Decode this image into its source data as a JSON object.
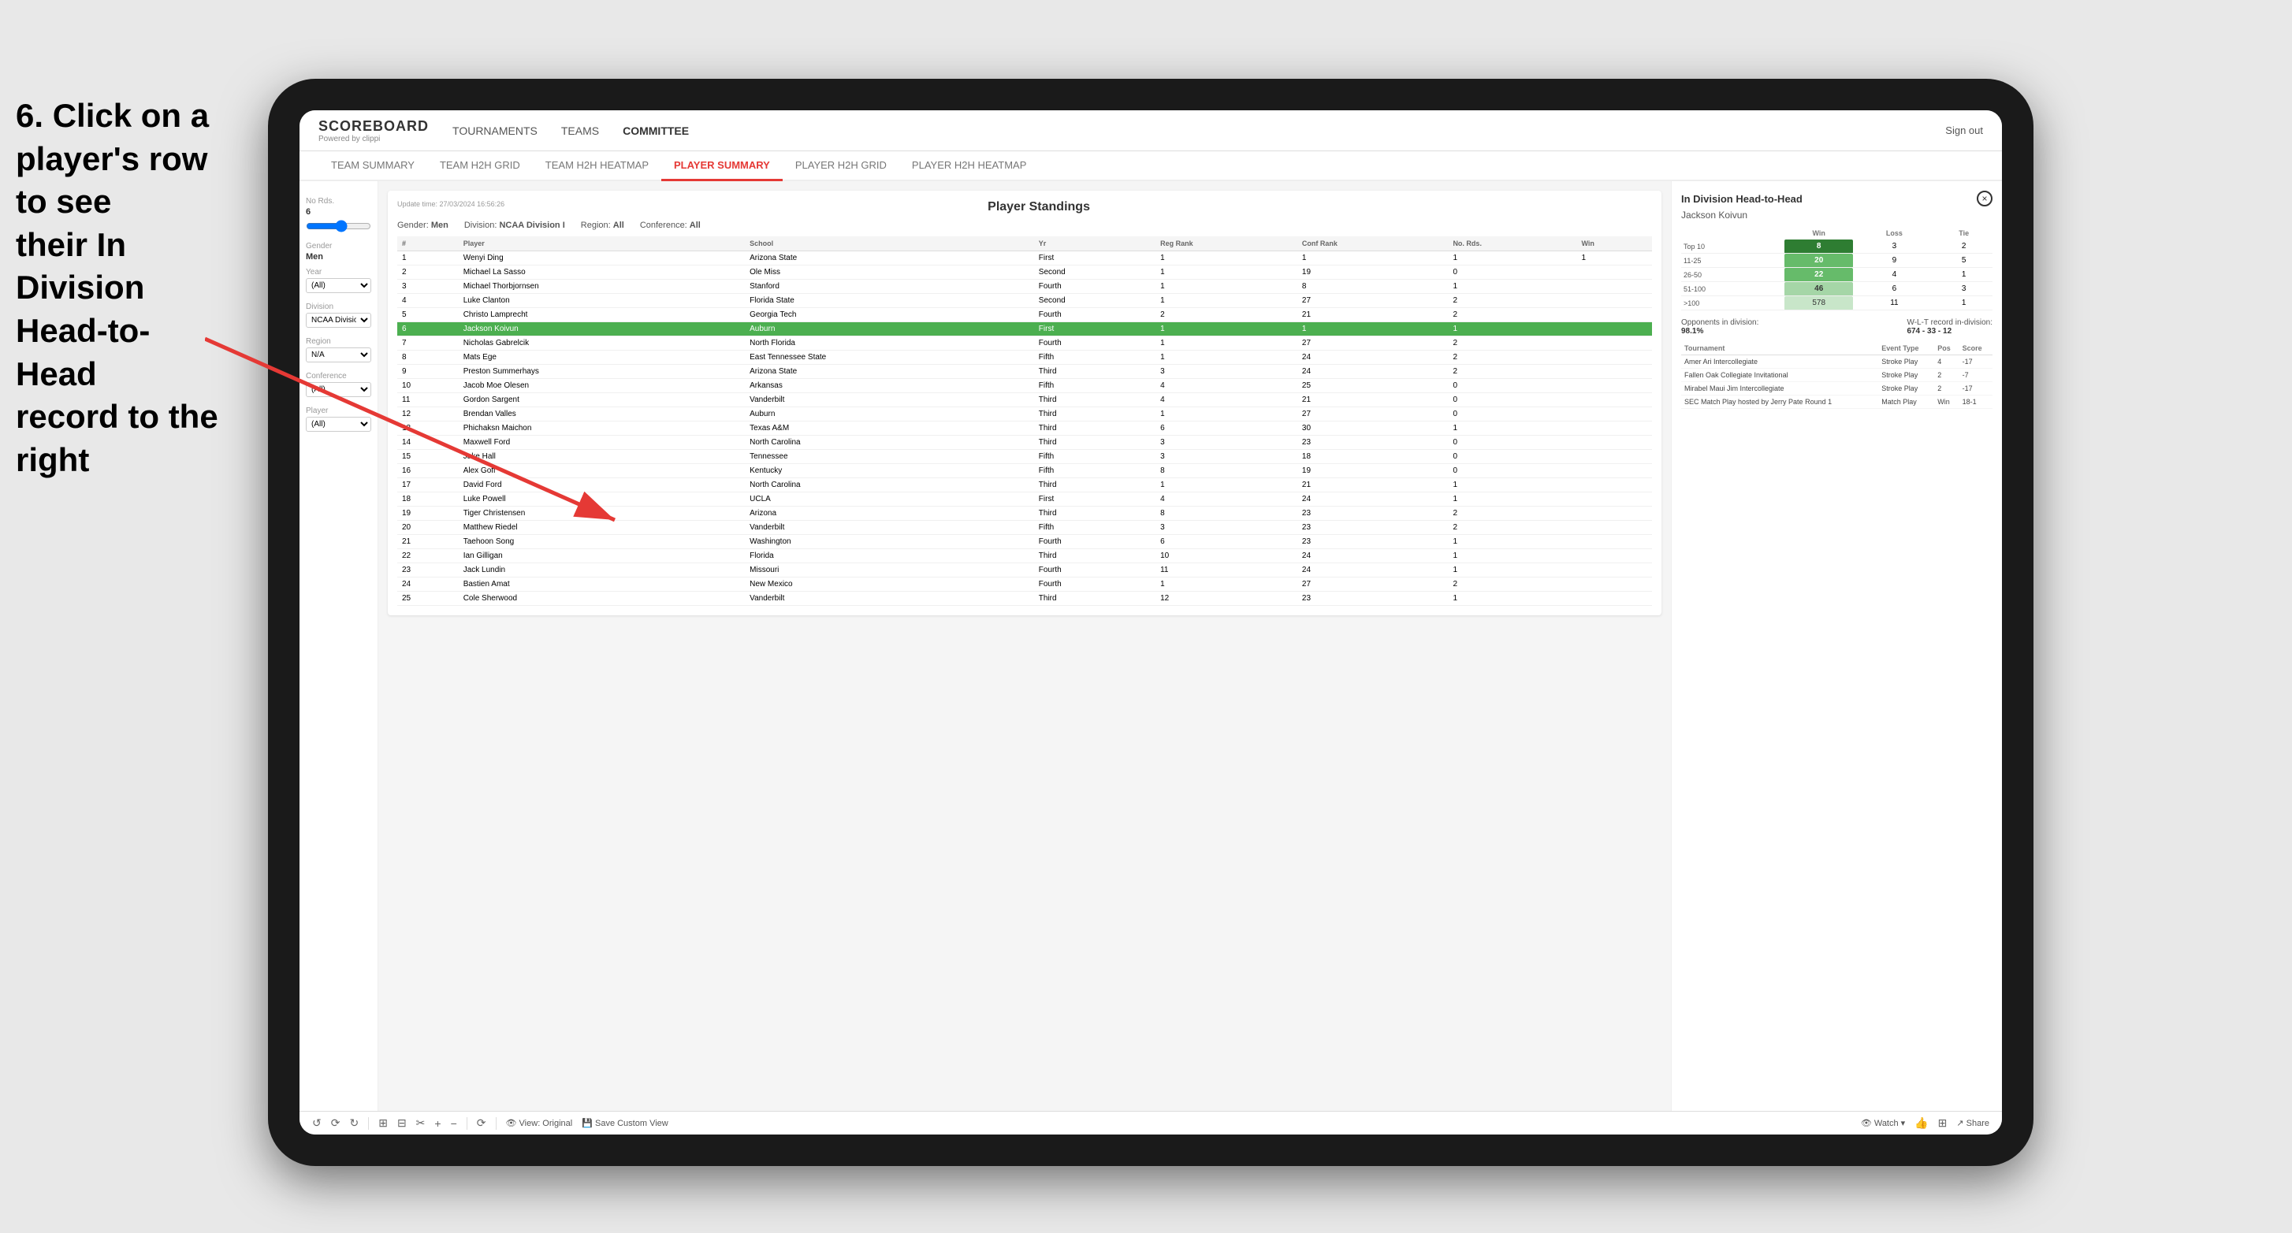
{
  "instruction": {
    "line1": "6. Click on a",
    "line2": "player's row to see",
    "line3": "their In Division",
    "line4": "Head-to-Head",
    "line5": "record to the right"
  },
  "nav": {
    "logo": "SCOREBOARD",
    "logo_sub": "Powered by clippi",
    "items": [
      "TOURNAMENTS",
      "TEAMS",
      "COMMITTEE"
    ],
    "sign_out": "Sign out"
  },
  "sub_nav": {
    "items": [
      "TEAM SUMMARY",
      "TEAM H2H GRID",
      "TEAM H2H HEATMAP",
      "PLAYER SUMMARY",
      "PLAYER H2H GRID",
      "PLAYER H2H HEATMAP"
    ]
  },
  "sidebar": {
    "no_rds_label": "No Rds.",
    "no_rds_value": "6",
    "gender_label": "Gender",
    "gender_value": "Men",
    "year_label": "Year",
    "year_value": "(All)",
    "division_label": "Division",
    "division_value": "NCAA Division I",
    "region_label": "Region",
    "region_value": "N/A",
    "conference_label": "Conference",
    "conference_value": "(All)",
    "player_label": "Player",
    "player_value": "(All)"
  },
  "standings": {
    "title": "Player Standings",
    "update_time": "Update time:",
    "update_date": "27/03/2024 16:56:26",
    "gender": "Men",
    "division": "NCAA Division I",
    "region": "All",
    "conference": "All",
    "columns": [
      "#",
      "Player",
      "School",
      "Yr",
      "Reg Rank",
      "Conf Rank",
      "No. Rds.",
      "Win"
    ],
    "rows": [
      {
        "num": "1",
        "player": "Wenyi Ding",
        "school": "Arizona State",
        "yr": "First",
        "reg": "1",
        "conf": "1",
        "rds": "1",
        "win": "1"
      },
      {
        "num": "2",
        "player": "Michael La Sasso",
        "school": "Ole Miss",
        "yr": "Second",
        "reg": "1",
        "conf": "19",
        "rds": "0",
        "win": ""
      },
      {
        "num": "3",
        "player": "Michael Thorbjornsen",
        "school": "Stanford",
        "yr": "Fourth",
        "reg": "1",
        "conf": "8",
        "rds": "1",
        "win": ""
      },
      {
        "num": "4",
        "player": "Luke Clanton",
        "school": "Florida State",
        "yr": "Second",
        "reg": "1",
        "conf": "27",
        "rds": "2",
        "win": ""
      },
      {
        "num": "5",
        "player": "Christo Lamprecht",
        "school": "Georgia Tech",
        "yr": "Fourth",
        "reg": "2",
        "conf": "21",
        "rds": "2",
        "win": ""
      },
      {
        "num": "6",
        "player": "Jackson Koivun",
        "school": "Auburn",
        "yr": "First",
        "reg": "1",
        "conf": "1",
        "rds": "1",
        "win": "",
        "highlighted": true
      },
      {
        "num": "7",
        "player": "Nicholas Gabrelcik",
        "school": "North Florida",
        "yr": "Fourth",
        "reg": "1",
        "conf": "27",
        "rds": "2",
        "win": ""
      },
      {
        "num": "8",
        "player": "Mats Ege",
        "school": "East Tennessee State",
        "yr": "Fifth",
        "reg": "1",
        "conf": "24",
        "rds": "2",
        "win": ""
      },
      {
        "num": "9",
        "player": "Preston Summerhays",
        "school": "Arizona State",
        "yr": "Third",
        "reg": "3",
        "conf": "24",
        "rds": "2",
        "win": ""
      },
      {
        "num": "10",
        "player": "Jacob Moe Olesen",
        "school": "Arkansas",
        "yr": "Fifth",
        "reg": "4",
        "conf": "25",
        "rds": "0",
        "win": ""
      },
      {
        "num": "11",
        "player": "Gordon Sargent",
        "school": "Vanderbilt",
        "yr": "Third",
        "reg": "4",
        "conf": "21",
        "rds": "0",
        "win": ""
      },
      {
        "num": "12",
        "player": "Brendan Valles",
        "school": "Auburn",
        "yr": "Third",
        "reg": "1",
        "conf": "27",
        "rds": "0",
        "win": ""
      },
      {
        "num": "13",
        "player": "Phichaksn Maichon",
        "school": "Texas A&M",
        "yr": "Third",
        "reg": "6",
        "conf": "30",
        "rds": "1",
        "win": ""
      },
      {
        "num": "14",
        "player": "Maxwell Ford",
        "school": "North Carolina",
        "yr": "Third",
        "reg": "3",
        "conf": "23",
        "rds": "0",
        "win": ""
      },
      {
        "num": "15",
        "player": "Jake Hall",
        "school": "Tennessee",
        "yr": "Fifth",
        "reg": "3",
        "conf": "18",
        "rds": "0",
        "win": ""
      },
      {
        "num": "16",
        "player": "Alex Goff",
        "school": "Kentucky",
        "yr": "Fifth",
        "reg": "8",
        "conf": "19",
        "rds": "0",
        "win": ""
      },
      {
        "num": "17",
        "player": "David Ford",
        "school": "North Carolina",
        "yr": "Third",
        "reg": "1",
        "conf": "21",
        "rds": "1",
        "win": ""
      },
      {
        "num": "18",
        "player": "Luke Powell",
        "school": "UCLA",
        "yr": "First",
        "reg": "4",
        "conf": "24",
        "rds": "1",
        "win": ""
      },
      {
        "num": "19",
        "player": "Tiger Christensen",
        "school": "Arizona",
        "yr": "Third",
        "reg": "8",
        "conf": "23",
        "rds": "2",
        "win": ""
      },
      {
        "num": "20",
        "player": "Matthew Riedel",
        "school": "Vanderbilt",
        "yr": "Fifth",
        "reg": "3",
        "conf": "23",
        "rds": "2",
        "win": ""
      },
      {
        "num": "21",
        "player": "Taehoon Song",
        "school": "Washington",
        "yr": "Fourth",
        "reg": "6",
        "conf": "23",
        "rds": "1",
        "win": ""
      },
      {
        "num": "22",
        "player": "Ian Gilligan",
        "school": "Florida",
        "yr": "Third",
        "reg": "10",
        "conf": "24",
        "rds": "1",
        "win": ""
      },
      {
        "num": "23",
        "player": "Jack Lundin",
        "school": "Missouri",
        "yr": "Fourth",
        "reg": "11",
        "conf": "24",
        "rds": "1",
        "win": ""
      },
      {
        "num": "24",
        "player": "Bastien Amat",
        "school": "New Mexico",
        "yr": "Fourth",
        "reg": "1",
        "conf": "27",
        "rds": "2",
        "win": ""
      },
      {
        "num": "25",
        "player": "Cole Sherwood",
        "school": "Vanderbilt",
        "yr": "Third",
        "reg": "12",
        "conf": "23",
        "rds": "1",
        "win": ""
      }
    ]
  },
  "h2h": {
    "title": "In Division Head-to-Head",
    "player_name": "Jackson Koivun",
    "close_label": "×",
    "table_headers": [
      "",
      "Win",
      "Loss",
      "Tie"
    ],
    "rows": [
      {
        "range": "Top 10",
        "win": "8",
        "loss": "3",
        "tie": "2",
        "win_class": "cell-green-dark"
      },
      {
        "range": "11-25",
        "win": "20",
        "loss": "9",
        "tie": "5",
        "win_class": "cell-green-med"
      },
      {
        "range": "26-50",
        "win": "22",
        "loss": "4",
        "tie": "1",
        "win_class": "cell-green-med"
      },
      {
        "range": "51-100",
        "win": "46",
        "loss": "6",
        "tie": "3",
        "win_class": "cell-green-light"
      },
      {
        "range": ">100",
        "win": "578",
        "loss": "11",
        "tie": "1",
        "win_class": "cell-green-pale"
      }
    ],
    "opponents_label": "Opponents in division:",
    "opponents_value": "98.1%",
    "record_label": "W-L-T record in-division:",
    "record_value": "674 - 33 - 12",
    "tournament_headers": [
      "Tournament",
      "Event Type",
      "Pos",
      "Score"
    ],
    "tournaments": [
      {
        "name": "Amer Ari Intercollegiate",
        "type": "Stroke Play",
        "pos": "4",
        "score": "-17"
      },
      {
        "name": "Fallen Oak Collegiate Invitational",
        "type": "Stroke Play",
        "pos": "2",
        "score": "-7"
      },
      {
        "name": "Mirabel Maui Jim Intercollegiate",
        "type": "Stroke Play",
        "pos": "2",
        "score": "-17"
      },
      {
        "name": "SEC Match Play hosted by Jerry Pate Round 1",
        "type": "Match Play",
        "pos": "Win",
        "score": "18-1"
      }
    ]
  },
  "toolbar": {
    "view_original": "View: Original",
    "save_custom": "Save Custom View",
    "watch": "Watch ▾",
    "share": "Share"
  }
}
